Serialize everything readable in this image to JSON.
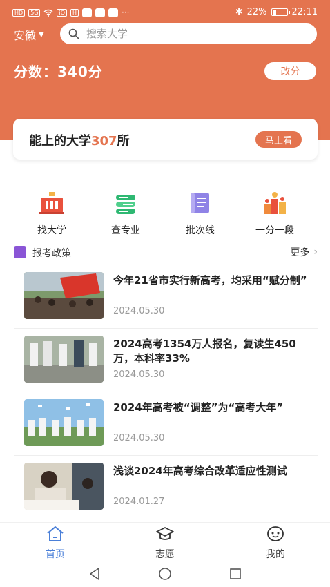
{
  "status_bar": {
    "left_chips": [
      "HD",
      "5G",
      "iQ",
      "H"
    ],
    "more": "···",
    "bluetooth": "✱",
    "battery": "22%",
    "time": "22:11"
  },
  "header": {
    "province": "安徽",
    "search_placeholder": "搜索大学",
    "score_text": "分数：340分",
    "change_score_label": "改分"
  },
  "reach_card": {
    "prefix": "能上的大学",
    "count": "307",
    "suffix": "所",
    "button_label": "马上看"
  },
  "quick_entries": [
    {
      "label": "找大学",
      "icon": "university-building-icon"
    },
    {
      "label": "查专业",
      "icon": "major-books-icon"
    },
    {
      "label": "批次线",
      "icon": "score-line-scroll-icon"
    },
    {
      "label": "一分一段",
      "icon": "score-ranking-podium-icon"
    }
  ],
  "policy": {
    "title": "报考政策",
    "more_label": "更多"
  },
  "news": [
    {
      "title": "今年21省市实行新高考，均采用“赋分制”",
      "date": "2024.05.30"
    },
    {
      "title": "2024高考1354万人报名，复读生450万，本科率33%",
      "date": "2024.05.30"
    },
    {
      "title": "2024年高考被“调整”为“高考大年”",
      "date": "2024.05.30"
    },
    {
      "title": "浅谈2024年高考综合改革适应性测试",
      "date": "2024.01.27"
    }
  ],
  "bottom_nav": [
    {
      "label": "首页",
      "icon": "home-icon",
      "active": true
    },
    {
      "label": "志愿",
      "icon": "graduation-cap-icon",
      "active": false
    },
    {
      "label": "我的",
      "icon": "face-icon",
      "active": false
    }
  ],
  "colors": {
    "brand": "#e4744f",
    "active_tab": "#4a7fd8"
  }
}
